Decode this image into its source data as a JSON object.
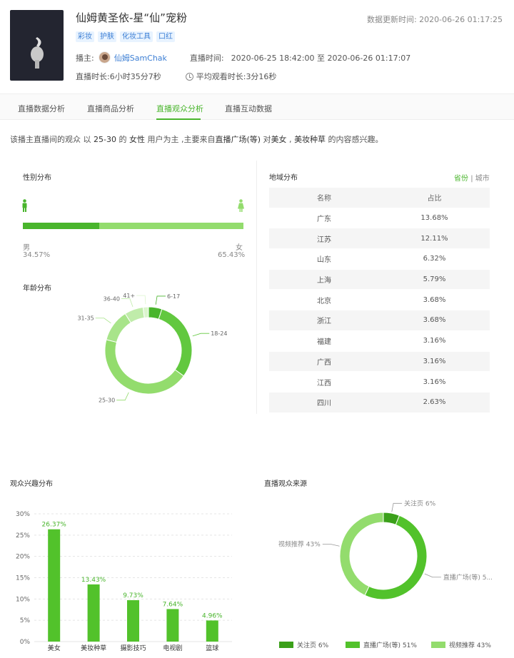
{
  "header": {
    "title": "仙姆黄圣依-星“仙”宠粉",
    "update_label": "数据更新时间:",
    "update_time": "2020-06-26 01:17:25",
    "tags": [
      "彩妆",
      "护肤",
      "化妆工具",
      "口红"
    ],
    "anchor_label": "播主:",
    "anchor_name": "仙姆SamChak",
    "live_time_label": "直播时间:",
    "live_time": "2020-06-25 18:42:00 至 2020-06-26 01:17:07",
    "duration_label": "直播时长:",
    "duration": "6小时35分7秒",
    "avg_watch_label": "平均观看时长:",
    "avg_watch": "3分16秒"
  },
  "tabs": [
    "直播数据分析",
    "直播商品分析",
    "直播观众分析",
    "直播互动数据"
  ],
  "active_tab": 2,
  "summary": {
    "p1": "该播主直播间的观众 以 ",
    "age": "25-30",
    "p2": " 的 ",
    "gender": "女性",
    "p3": " 用户为主 ,主要来自",
    "source": "直播广场(等)",
    "p4": " 对",
    "int1": "美女",
    "p5": " , ",
    "int2": "美妆种草",
    "p6": " 的内容感兴趣。"
  },
  "gender": {
    "title": "性别分布",
    "male_label": "男",
    "male_pct": "34.57%",
    "male_value": 34.57,
    "female_label": "女",
    "female_pct": "65.43%"
  },
  "age": {
    "title": "年龄分布",
    "slices": [
      {
        "label": "6-17",
        "value": 5
      },
      {
        "label": "18-24",
        "value": 30
      },
      {
        "label": "25-30",
        "value": 44
      },
      {
        "label": "31-35",
        "value": 12
      },
      {
        "label": "36-40",
        "value": 7
      },
      {
        "label": "41+",
        "value": 2
      }
    ]
  },
  "region": {
    "title": "地域分布",
    "switch_on": "省份",
    "switch_sep": "|",
    "switch_off": "城市",
    "headers": [
      "名称",
      "占比"
    ],
    "rows": [
      [
        "广东",
        "13.68%"
      ],
      [
        "江苏",
        "12.11%"
      ],
      [
        "山东",
        "6.32%"
      ],
      [
        "上海",
        "5.79%"
      ],
      [
        "北京",
        "3.68%"
      ],
      [
        "浙江",
        "3.68%"
      ],
      [
        "福建",
        "3.16%"
      ],
      [
        "广西",
        "3.16%"
      ],
      [
        "江西",
        "3.16%"
      ],
      [
        "四川",
        "2.63%"
      ]
    ]
  },
  "interest": {
    "title": "观众兴趣分布"
  },
  "source": {
    "title": "直播观众来源"
  },
  "chart_data": [
    {
      "type": "bar",
      "title": "观众兴趣分布",
      "categories": [
        "美女",
        "美妆种草",
        "摄影技巧",
        "电视剧",
        "篮球"
      ],
      "values": [
        26.37,
        13.43,
        9.73,
        7.64,
        4.96
      ],
      "value_labels": [
        "26.37%",
        "13.43%",
        "9.73%",
        "7.64%",
        "4.96%"
      ],
      "y_ticks": [
        "0%",
        "5%",
        "10%",
        "15%",
        "20%",
        "25%",
        "30%"
      ],
      "ylim": [
        0,
        30
      ],
      "grid": true,
      "color": "#52c22b"
    },
    {
      "type": "pie",
      "title": "直播观众来源",
      "labels": [
        "关注页 6%",
        "直播广场(等) 5...",
        "视频推荐 43%"
      ],
      "legend": [
        "关注页 6%",
        "直播广场(等) 51%",
        "视频推荐 43%"
      ],
      "values": [
        6,
        51,
        43
      ],
      "colors": [
        "#3ba01a",
        "#52c22b",
        "#93dc6d"
      ]
    }
  ]
}
